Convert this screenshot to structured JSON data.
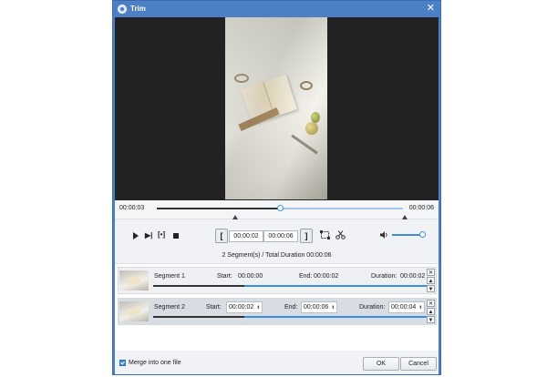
{
  "window": {
    "title": "Trim",
    "close_glyph": "✕",
    "icon": "app-logo-icon"
  },
  "player": {
    "time_start": "00:00:03",
    "time_end": "00:00:06",
    "playhead_fraction": 0.5,
    "controls": {
      "next_frame": "▶|",
      "clip": "[•]"
    },
    "start_time": "00:00:02",
    "end_time": "00:00:06",
    "bracket_left": "[",
    "bracket_right": "]"
  },
  "summary": "2 Segment(s) / Total Duration 00:00:06",
  "segments": [
    {
      "name": "Segment 1",
      "start_label": "Start:",
      "start": "00:00:00",
      "end_label": "End:",
      "end": "00:00:02",
      "duration_label": "Duration:",
      "duration": "00:00:02",
      "progress_fraction": 0.33
    },
    {
      "name": "Segment 2",
      "start_label": "Start:",
      "start": "00:00:02",
      "end_label": "End:",
      "end": "00:00:06",
      "duration_label": "Duration:",
      "duration": "00:00:04",
      "progress_fraction": 0.33
    }
  ],
  "segment_side": {
    "remove": "✕",
    "up": "▲",
    "down": "▼"
  },
  "footer": {
    "merge_label": "Merge into one file",
    "merge_checked": true,
    "ok_label": "OK",
    "cancel_label": "Cancel"
  },
  "colors": {
    "accent": "#3b8de0",
    "titlebar": "#4d7fc5"
  }
}
